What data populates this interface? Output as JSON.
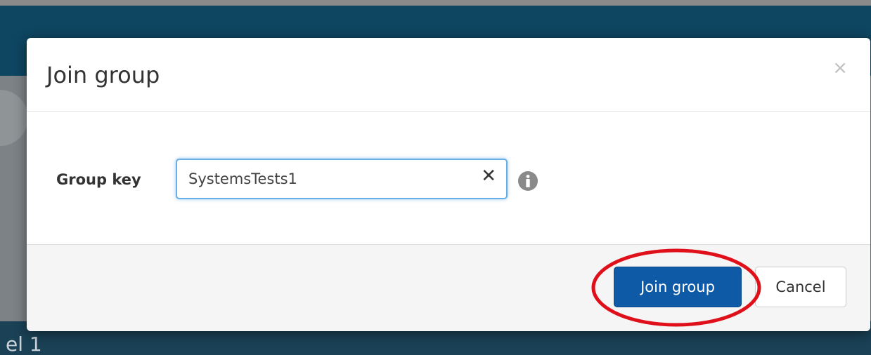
{
  "background": {
    "partial_label": "el 1"
  },
  "dialog": {
    "title": "Join group",
    "close_symbol": "×",
    "group_key_label": "Group key",
    "group_key_value": "SystemsTests1",
    "clear_symbol": "✕",
    "info_icon": "info-circle",
    "join_button_label": "Join group",
    "cancel_button_label": "Cancel"
  },
  "colors": {
    "header_background": "#0e4560",
    "primary_button": "#0f5aa6",
    "input_focus_border": "#66afe9",
    "annotation_circle": "#e0101a"
  }
}
